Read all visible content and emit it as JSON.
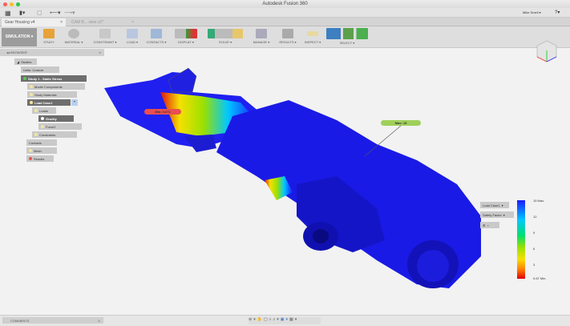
{
  "window": {
    "title": "Autodesk Fusion 360",
    "user": "Mike Smell"
  },
  "tabs": [
    {
      "label": "Gear Housing v4",
      "active": true
    },
    {
      "label": "CAM B...  view v2*",
      "active": false
    }
  ],
  "toolbar": {
    "workspace": "SIMULATION",
    "groups": [
      "STUDY",
      "MATERIAL",
      "CONSTRAINT",
      "LOAD",
      "CONTACTS",
      "DISPLAY",
      "SOLVE",
      "MANAGE",
      "RESULTS",
      "INSPECT",
      "SELECT"
    ]
  },
  "browser": {
    "title": "BROWSER",
    "nodes": [
      {
        "label": "Studies",
        "level": 0
      },
      {
        "label": "Units: Custom",
        "level": 1
      },
      {
        "label": "Study 1 - Static Stress",
        "level": 1,
        "selected": true
      },
      {
        "label": "Model Components",
        "level": 2
      },
      {
        "label": "Study Materials",
        "level": 2
      },
      {
        "label": "Load Case1",
        "level": 2,
        "selected": true
      },
      {
        "label": "Loads",
        "level": 3
      },
      {
        "label": "Gravity",
        "level": 4,
        "selected": true
      },
      {
        "label": "Force2",
        "level": 4
      },
      {
        "label": "Constraints",
        "level": 3
      },
      {
        "label": "Contacts",
        "level": 2
      },
      {
        "label": "Mesh",
        "level": 2
      },
      {
        "label": "Results",
        "level": 2
      }
    ]
  },
  "probes": {
    "min": "Min: 0.671",
    "max": "Max: 15"
  },
  "legend": {
    "load_case": "Load Case1",
    "result_type": "Safety Factor",
    "ticks": [
      "15 Max.",
      "12",
      "9",
      "6",
      "3",
      "0.67 Min."
    ],
    "colors": [
      "#1a1aff",
      "#00c8ff",
      "#00e070",
      "#9be000",
      "#f5e000",
      "#ff8000",
      "#e00000"
    ]
  },
  "bottom": {
    "comments": "COMMENTS"
  }
}
